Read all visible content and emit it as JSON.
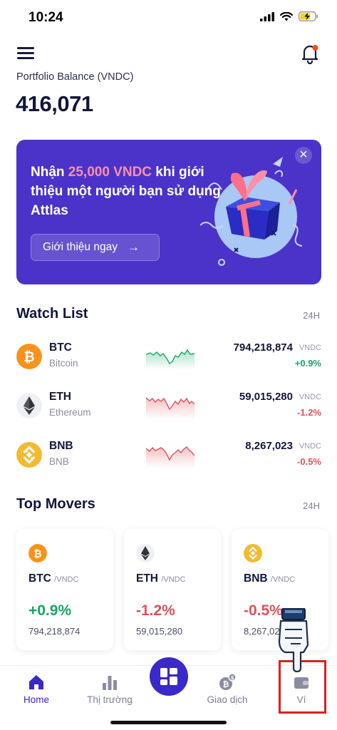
{
  "status_bar": {
    "time": "10:24"
  },
  "header": {
    "balance_label": "Portfolio Balance (VNDC)",
    "balance_value": "416,071"
  },
  "promo": {
    "text_before": "Nhận ",
    "text_highlight": "25,000 VNDC",
    "text_after": " khi giới thiệu một người bạn sử dụng Attlas",
    "button_label": "Giới thiệu ngay",
    "button_arrow": "→",
    "close_symbol": "×"
  },
  "watchlist": {
    "title": "Watch List",
    "period": "24H",
    "items": [
      {
        "symbol": "BTC",
        "name": "Bitcoin",
        "price": "794,218,874",
        "unit": "VNDC",
        "change": "+0.9%",
        "trend": "up"
      },
      {
        "symbol": "ETH",
        "name": "Ethereum",
        "price": "59,015,280",
        "unit": "VNDC",
        "change": "-1.2%",
        "trend": "down"
      },
      {
        "symbol": "BNB",
        "name": "BNB",
        "price": "8,267,023",
        "unit": "VNDC",
        "change": "-0.5%",
        "trend": "down"
      }
    ]
  },
  "top_movers": {
    "title": "Top Movers",
    "period": "24H",
    "items": [
      {
        "symbol": "BTC",
        "pair": "/VNDC",
        "change": "+0.9%",
        "price": "794,218,874"
      },
      {
        "symbol": "ETH",
        "pair": "/VNDC",
        "change": "-1.2%",
        "price": "59,015,280"
      },
      {
        "symbol": "BNB",
        "pair": "/VNDC",
        "change": "-0.5%",
        "price": "8,267,02"
      }
    ]
  },
  "tabbar": {
    "items": [
      {
        "label": "Home",
        "icon": "home-icon",
        "active": true
      },
      {
        "label": "Thị trường",
        "icon": "bar-chart-icon",
        "active": false
      },
      {
        "label": "Giao dịch",
        "icon": "coins-icon",
        "active": false
      },
      {
        "label": "Ví",
        "icon": "wallet-icon",
        "active": false
      }
    ]
  },
  "colors": {
    "brand": "#3b28c8",
    "promo_bg": "#4b33c9",
    "positive": "#13a863",
    "negative": "#e0505a",
    "btc": "#f7931a",
    "bnb": "#f3ba2f",
    "highlight": "#d42424"
  }
}
